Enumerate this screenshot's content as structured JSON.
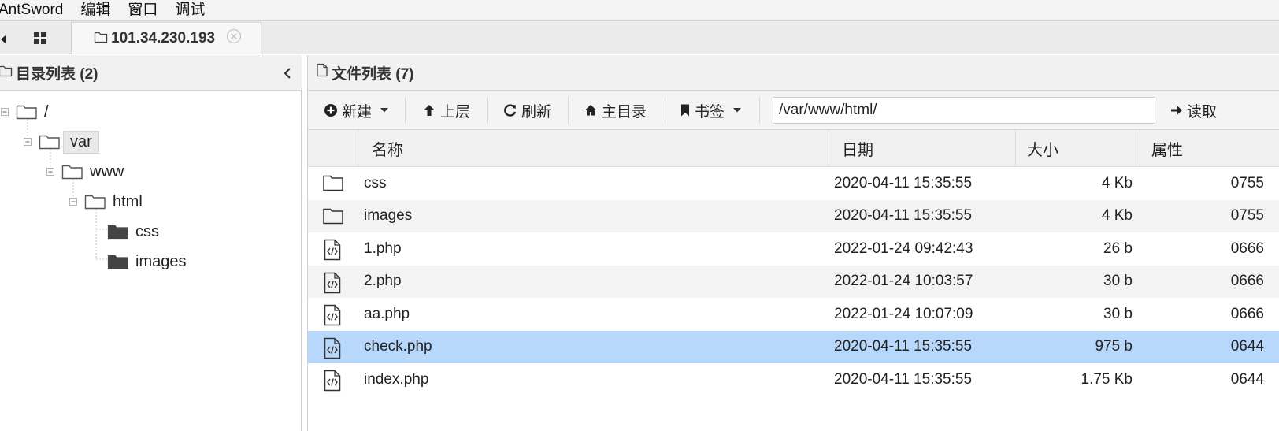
{
  "menubar": {
    "items": [
      "AntSword",
      "编辑",
      "窗口",
      "调试"
    ]
  },
  "tabs": {
    "active_label": "101.34.230.193"
  },
  "left_panel": {
    "title": "目录列表 (2)",
    "tree": [
      {
        "label": "/",
        "level": 0,
        "type": "folder-open"
      },
      {
        "label": "var",
        "level": 1,
        "type": "folder-open",
        "selected": true
      },
      {
        "label": "www",
        "level": 2,
        "type": "folder-open"
      },
      {
        "label": "html",
        "level": 3,
        "type": "folder-open"
      },
      {
        "label": "css",
        "level": 4,
        "type": "folder-closed"
      },
      {
        "label": "images",
        "level": 4,
        "type": "folder-closed"
      }
    ]
  },
  "right_panel": {
    "title": "文件列表 (7)",
    "toolbar": {
      "new_label": "新建",
      "up_label": "上层",
      "refresh_label": "刷新",
      "home_label": "主目录",
      "bookmark_label": "书签",
      "path_value": "/var/www/html/",
      "read_label": "读取"
    },
    "columns": {
      "name": "名称",
      "date": "日期",
      "size": "大小",
      "attr": "属性"
    },
    "rows": [
      {
        "icon": "folder-icon",
        "name": "css",
        "date": "2020-04-11 15:35:55",
        "size": "4 Kb",
        "attr": "0755"
      },
      {
        "icon": "folder-icon",
        "name": "images",
        "date": "2020-04-11 15:35:55",
        "size": "4 Kb",
        "attr": "0755"
      },
      {
        "icon": "code-file-icon",
        "name": "1.php",
        "date": "2022-01-24 09:42:43",
        "size": "26 b",
        "attr": "0666"
      },
      {
        "icon": "code-file-icon",
        "name": "2.php",
        "date": "2022-01-24 10:03:57",
        "size": "30 b",
        "attr": "0666"
      },
      {
        "icon": "code-file-icon",
        "name": "aa.php",
        "date": "2022-01-24 10:07:09",
        "size": "30 b",
        "attr": "0666"
      },
      {
        "icon": "code-file-icon",
        "name": "check.php",
        "date": "2020-04-11 15:35:55",
        "size": "975 b",
        "attr": "0644",
        "selected": true
      },
      {
        "icon": "code-file-icon",
        "name": "index.php",
        "date": "2020-04-11 15:35:55",
        "size": "1.75 Kb",
        "attr": "0644"
      }
    ]
  },
  "colors": {
    "selected_row": "#b8d8fb",
    "header_bg": "#f1f1f1",
    "stripe": "#f3f3f3"
  }
}
